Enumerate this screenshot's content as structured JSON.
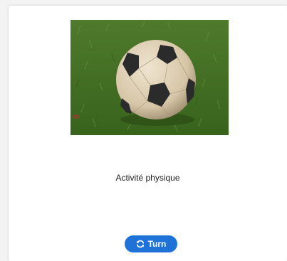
{
  "card": {
    "image_subject": "soccer ball on grass",
    "caption": "Activité physique",
    "turn_button": {
      "label": "Turn",
      "icon": "refresh-icon",
      "color": "#1f73d8"
    }
  }
}
